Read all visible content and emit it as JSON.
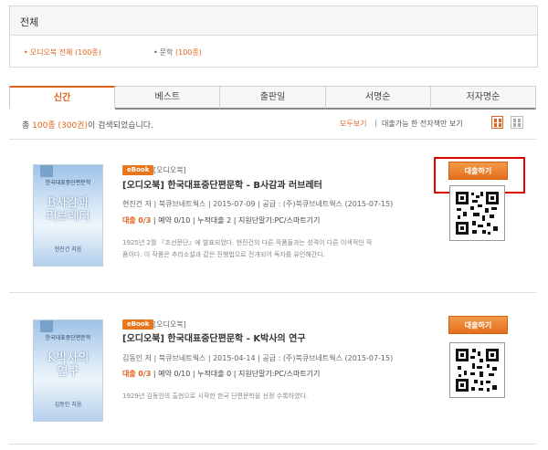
{
  "category": {
    "title": "전체",
    "links": [
      {
        "bullet": "•",
        "label": "오디오북 전체 (100종)"
      },
      {
        "bullet": "•",
        "label": "문학",
        "count": "(100종)"
      }
    ]
  },
  "tabs": [
    "신간",
    "베스트",
    "출판일",
    "서명순",
    "저자명순"
  ],
  "result": {
    "prefix": "총 ",
    "count": "100종 (300권)",
    "suffix": "이 검색되었습니다."
  },
  "view": {
    "all": "모두보기",
    "sep": "|",
    "ebook_only": "대출가능 한 전자책만 보기"
  },
  "books": [
    {
      "badge": "eBook",
      "type": "[오디오북]",
      "title": "[오디오북] 한국대표중단편문학 - B사감과 러브레터",
      "meta": "현진건 저 | 북큐브네트웍스 | 2015-07-09 | 공급 : (주)북큐브네트웍스 (2015-07-15)",
      "loan_label": "대출",
      "loan_val": "0/3",
      "loan_rest": " | 예약 0/10 | 누적대출 2 | 지원단말기:PC/스마트기기",
      "desc_lines": [
        "1925년 2월 『조선문단』에 발표되었다. 현진건의 다른 작품들과는 성격이 다른 이색적인 작",
        "품이다. 이 작품은 추리소설과 같은 진행법으로 전개되어 독자를 유인해간다."
      ],
      "cover_sub": "한국대표중단편문학",
      "cover_title_1": "B사감과",
      "cover_title_2": "러브레터",
      "cover_author": "현진건 지음",
      "borrow": "대출하기"
    },
    {
      "badge": "eBook",
      "type": "[오디오북]",
      "title": "[오디오북] 한국대표중단편문학 - K박사의 연구",
      "meta": "김동인 저 | 북큐브네트웍스 | 2015-04-14 | 공급 : (주)북큐브네트웍스 (2015-07-15)",
      "loan_label": "대출",
      "loan_val": "0/3",
      "loan_rest": " | 예약 0/10 | 누적대출 0 | 지원단말기:PC/스마트기기",
      "desc_lines": [
        "1929년 김동인의 출현으로 시작한 한국 단편문학을 선정 수록하였다."
      ],
      "cover_sub": "한국대표중단편문학",
      "cover_title_1": "K박사의",
      "cover_title_2": "연구",
      "cover_author": "김동인 지음",
      "borrow": "대출하기"
    }
  ],
  "colors": {
    "accent": "#e0631c",
    "highlight": "#e00000"
  }
}
